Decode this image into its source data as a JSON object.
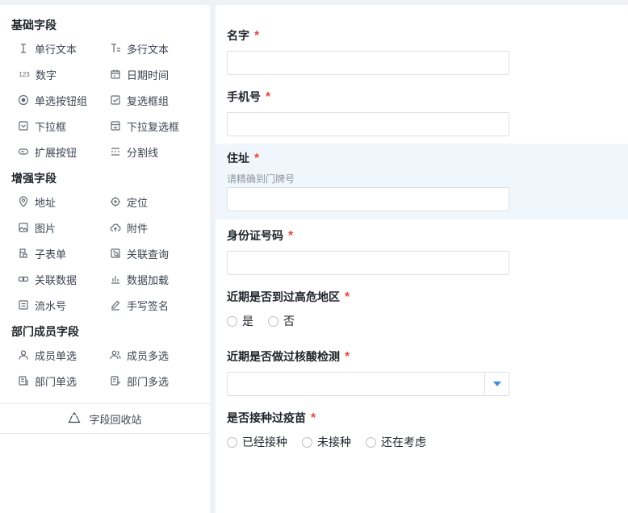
{
  "sidebar": {
    "groups": [
      {
        "title": "基础字段",
        "items": [
          {
            "label": "单行文本",
            "icon": "single-line-text-icon"
          },
          {
            "label": "多行文本",
            "icon": "multi-line-text-icon"
          },
          {
            "label": "数字",
            "icon": "number-icon",
            "icon_text": "123"
          },
          {
            "label": "日期时间",
            "icon": "calendar-icon"
          },
          {
            "label": "单选按钮组",
            "icon": "radio-icon"
          },
          {
            "label": "复选框组",
            "icon": "checkbox-icon"
          },
          {
            "label": "下拉框",
            "icon": "dropdown-icon"
          },
          {
            "label": "下拉复选框",
            "icon": "dropdown-checkbox-icon"
          },
          {
            "label": "扩展按钮",
            "icon": "extend-button-icon"
          },
          {
            "label": "分割线",
            "icon": "divider-icon"
          }
        ]
      },
      {
        "title": "增强字段",
        "items": [
          {
            "label": "地址",
            "icon": "map-pin-icon"
          },
          {
            "label": "定位",
            "icon": "locate-icon"
          },
          {
            "label": "图片",
            "icon": "image-icon"
          },
          {
            "label": "附件",
            "icon": "cloud-upload-icon"
          },
          {
            "label": "子表单",
            "icon": "subform-icon"
          },
          {
            "label": "关联查询",
            "icon": "link-query-icon"
          },
          {
            "label": "关联数据",
            "icon": "link-data-icon"
          },
          {
            "label": "数据加载",
            "icon": "bar-chart-icon"
          },
          {
            "label": "流水号",
            "icon": "serial-number-icon"
          },
          {
            "label": "手写签名",
            "icon": "pen-icon"
          }
        ]
      },
      {
        "title": "部门成员字段",
        "items": [
          {
            "label": "成员单选",
            "icon": "user-icon"
          },
          {
            "label": "成员多选",
            "icon": "users-icon"
          },
          {
            "label": "部门单选",
            "icon": "department-icon"
          },
          {
            "label": "部门多选",
            "icon": "departments-icon"
          }
        ]
      }
    ],
    "recycle_label": "字段回收站",
    "recycle_icon": "recycle-icon"
  },
  "form": {
    "fields": [
      {
        "label": "名字",
        "required": "*",
        "type": "input",
        "value": ""
      },
      {
        "label": "手机号",
        "required": "*",
        "type": "input",
        "value": ""
      },
      {
        "label": "住址",
        "required": "*",
        "type": "input",
        "hint": "请精确到门牌号",
        "value": "",
        "active": true
      },
      {
        "label": "身份证号码",
        "required": "*",
        "type": "input",
        "value": ""
      },
      {
        "label": "近期是否到过高危地区",
        "required": "*",
        "type": "radio",
        "options": [
          "是",
          "否"
        ]
      },
      {
        "label": "近期是否做过核酸检测",
        "required": "*",
        "type": "select",
        "value": ""
      },
      {
        "label": "是否接种过疫苗",
        "required": "*",
        "type": "radio",
        "options": [
          "已经接种",
          "未接种",
          "还在考虑"
        ]
      }
    ]
  },
  "colors": {
    "required": "#e04b3e",
    "active_bg": "#f0f7fc",
    "caret": "#3b8fd9",
    "border": "#dee0e3"
  }
}
